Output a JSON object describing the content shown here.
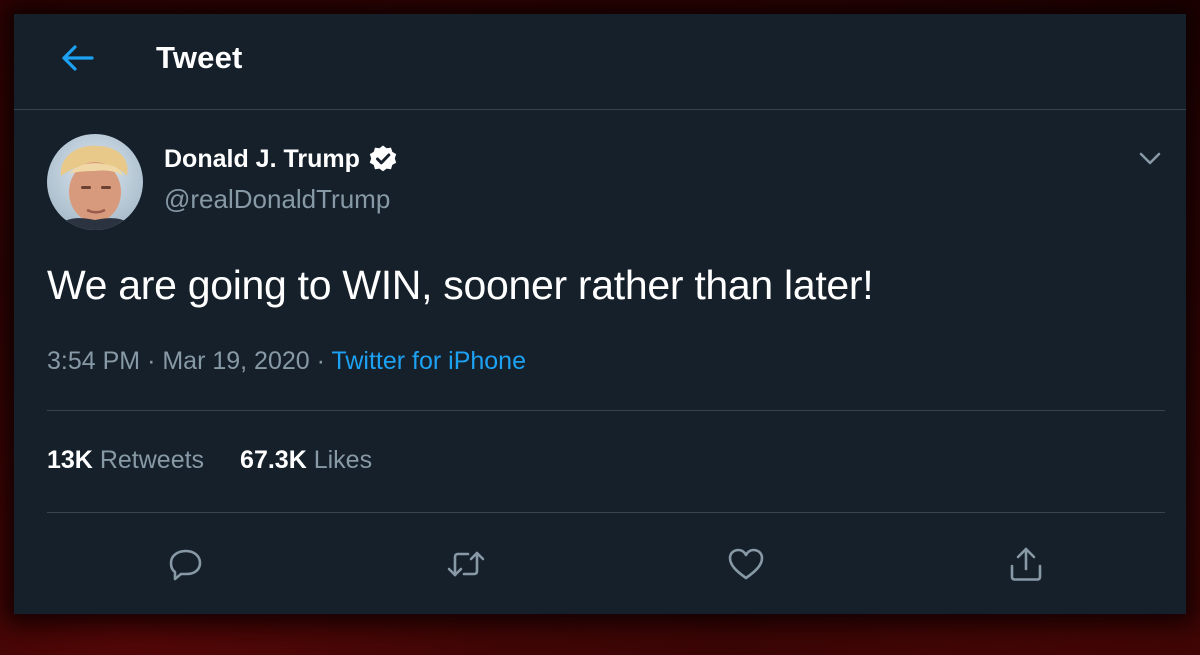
{
  "header": {
    "title": "Tweet",
    "back_icon": "arrow-left-icon"
  },
  "author": {
    "name": "Donald J. Trump",
    "handle": "@realDonaldTrump",
    "verified_icon": "verified-badge-icon"
  },
  "tweet": {
    "text": "We are going to WIN, sooner rather than later!",
    "time": "3:54 PM",
    "date": "Mar 19, 2020",
    "separator": "·",
    "source": "Twitter for iPhone"
  },
  "stats": {
    "retweets_count": "13K",
    "retweets_label": "Retweets",
    "likes_count": "67.3K",
    "likes_label": "Likes"
  },
  "actions": [
    {
      "name": "reply",
      "icon": "reply-icon"
    },
    {
      "name": "retweet",
      "icon": "retweet-icon"
    },
    {
      "name": "like",
      "icon": "heart-icon"
    },
    {
      "name": "share",
      "icon": "share-icon"
    }
  ],
  "colors": {
    "background": "#15202b",
    "accent": "#1da1f2",
    "secondary_text": "#8899a6",
    "border": "#38444d"
  }
}
